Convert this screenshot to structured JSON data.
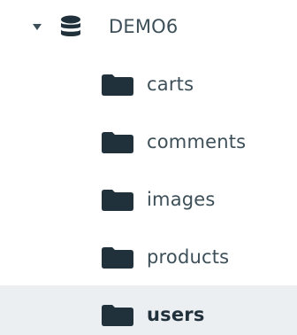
{
  "database": {
    "name": "DEMO6",
    "expanded": true,
    "icon": "database-icon",
    "caret_icon": "caret-down-icon"
  },
  "collections": [
    {
      "label": "carts",
      "icon": "folder-icon"
    },
    {
      "label": "comments",
      "icon": "folder-icon"
    },
    {
      "label": "images",
      "icon": "folder-icon"
    },
    {
      "label": "products",
      "icon": "folder-icon"
    },
    {
      "label": "users",
      "icon": "folder-icon",
      "selected": true
    }
  ],
  "colors": {
    "text": "#3d4f58",
    "selected_text": "#21313c",
    "selected_background": "#eceff1",
    "icon": "#21313c"
  }
}
